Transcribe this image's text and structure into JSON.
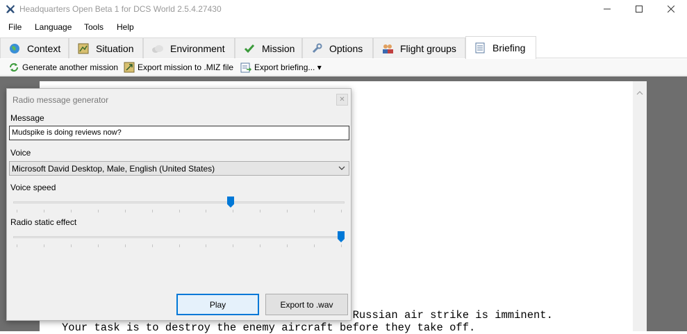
{
  "window": {
    "title": "Headquarters Open Beta 1 for DCS World 2.5.4.27430",
    "controls": {
      "minimize": "—",
      "maximize": "☐",
      "close": "✕"
    }
  },
  "menu": [
    "File",
    "Language",
    "Tools",
    "Help"
  ],
  "tabs": [
    {
      "label": "Context",
      "icon": "globe-icon"
    },
    {
      "label": "Situation",
      "icon": "map-icon"
    },
    {
      "label": "Environment",
      "icon": "cloud-icon"
    },
    {
      "label": "Mission",
      "icon": "checkmark-icon"
    },
    {
      "label": "Options",
      "icon": "wrench-icon"
    },
    {
      "label": "Flight groups",
      "icon": "pilots-icon"
    },
    {
      "label": "Briefing",
      "icon": "document-icon",
      "active": true
    }
  ],
  "toolbar": {
    "generate": "Generate another mission",
    "export_miz": "Export mission to .MIZ file",
    "export_briefing": "Export briefing... ▾"
  },
  "briefing": {
    "line1_partial": "Special forces have informed us that a large Russian air strike is imminent.",
    "line2": "Your task is to destroy the enemy aircraft before they take off."
  },
  "dialog": {
    "title": "Radio message generator",
    "close_glyph": "✕",
    "message_label": "Message",
    "message_value": "Mudspike is doing reviews now?",
    "voice_label": "Voice",
    "voice_value": "Microsoft David Desktop, Male, English (United States)",
    "speed_label": "Voice speed",
    "speed_value": 0.66,
    "static_label": "Radio static effect",
    "static_value": 1.0,
    "play_label": "Play",
    "export_label": "Export to .wav"
  },
  "colors": {
    "accent": "#0078d7",
    "workspace": "#6e6e6e"
  }
}
